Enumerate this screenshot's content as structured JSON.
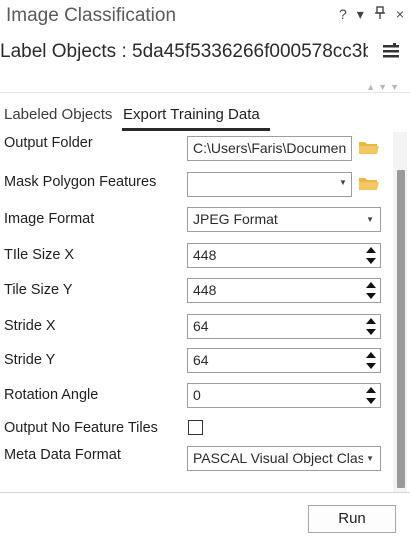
{
  "pane": {
    "title": "Image Classification",
    "subtitle": "Label Objects : 5da45f5336266f000578cc3b..."
  },
  "titlebar_icons": {
    "help": "?",
    "menu": "▾",
    "pin": "⊥",
    "close": "×"
  },
  "tabs": [
    {
      "label": "Labeled Objects",
      "active": false
    },
    {
      "label": "Export Training Data",
      "active": true
    }
  ],
  "form": {
    "output_folder": {
      "label": "Output Folder",
      "value": "C:\\Users\\Faris\\Documen"
    },
    "mask_polygon": {
      "label": "Mask Polygon Features",
      "value": ""
    },
    "image_format": {
      "label": "Image Format",
      "value": "JPEG Format"
    },
    "tile_size_x": {
      "label": "TIle Size X",
      "value": "448"
    },
    "tile_size_y": {
      "label": "Tile Size Y",
      "value": "448"
    },
    "stride_x": {
      "label": "Stride X",
      "value": "64"
    },
    "stride_y": {
      "label": "Stride Y",
      "value": "64"
    },
    "rotation_angle": {
      "label": "Rotation Angle",
      "value": "0"
    },
    "output_no_feature_tiles": {
      "label": "Output No Feature Tiles",
      "checked": false
    },
    "meta_data_format": {
      "label": "Meta Data Format",
      "value": "PASCAL Visual Object Clas"
    }
  },
  "footer": {
    "run_label": "Run"
  },
  "colors": {
    "folder": "#e8b84a",
    "accent": "#2a2a2a"
  }
}
